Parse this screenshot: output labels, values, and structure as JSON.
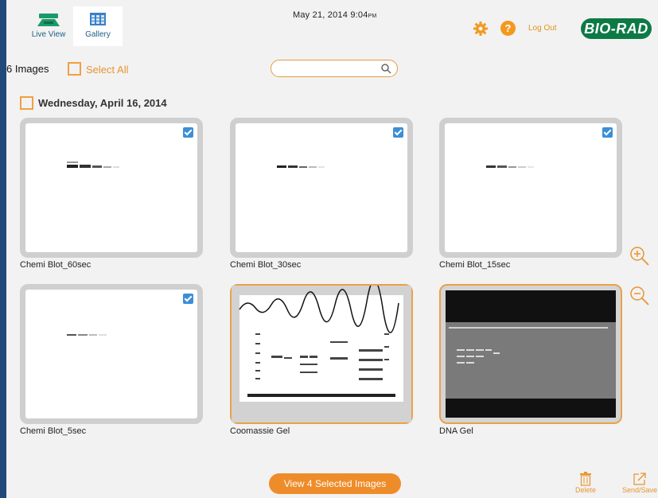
{
  "header": {
    "nav": [
      {
        "label": "Live View",
        "icon": "live-view-icon"
      },
      {
        "label": "Gallery",
        "icon": "gallery-icon"
      }
    ],
    "date": "May 21, 2014",
    "time": "9:04",
    "ampm": "PM",
    "logout_label": "Log Out",
    "logo_text": "BIO-RAD",
    "help_glyph": "?"
  },
  "toolbar": {
    "count_label": "6 Images",
    "select_all_label": "Select All",
    "search_placeholder": ""
  },
  "group": {
    "date_label": "Wednesday, April 16, 2014"
  },
  "images": [
    {
      "name": "Chemi Blot_60sec",
      "checked": true,
      "kind": "blot"
    },
    {
      "name": "Chemi Blot_30sec",
      "checked": true,
      "kind": "blot"
    },
    {
      "name": "Chemi Blot_15sec",
      "checked": true,
      "kind": "blot"
    },
    {
      "name": "Chemi Blot_5sec",
      "checked": true,
      "kind": "blot"
    },
    {
      "name": "Coomassie Gel",
      "checked": false,
      "kind": "coomassie"
    },
    {
      "name": "DNA Gel",
      "checked": false,
      "kind": "dna"
    }
  ],
  "footer": {
    "view_selected_label": "View 4 Selected Images",
    "delete_label": "Delete",
    "send_save_label": "Send/Save"
  },
  "colors": {
    "accent": "#ee8c2a",
    "brand": "#0d7a45",
    "checkbox_blue": "#3b8fd6",
    "frame_border": "#1f4a7a"
  }
}
